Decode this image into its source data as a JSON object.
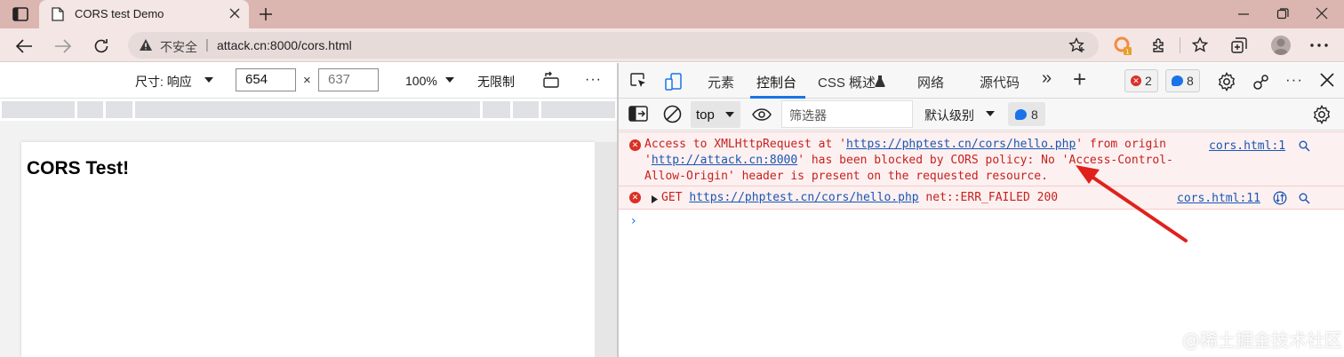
{
  "browser": {
    "tab_title": "CORS test Demo",
    "address": {
      "security_label": "不安全",
      "separator": "|",
      "url": "attack.cn:8000/cors.html"
    }
  },
  "device_toolbar": {
    "dimensions_label": "尺寸: 响应",
    "width_value": "654",
    "times": "×",
    "height_value": "637",
    "zoom_label": "100%",
    "throttle_label": "无限制",
    "more_label": "···"
  },
  "page": {
    "heading": "CORS Test!"
  },
  "devtools": {
    "tabs": [
      {
        "label": "元素"
      },
      {
        "label": "控制台",
        "active": true
      },
      {
        "label": "CSS 概述"
      },
      {
        "label": "网络"
      },
      {
        "label": "源代码"
      }
    ],
    "more_tabs": "»",
    "add_tab": "+",
    "error_count": "2",
    "issue_count": "8",
    "more_label": "···"
  },
  "console_toolbar": {
    "context": "top",
    "filter_placeholder": "筛选器",
    "level_label": "默认级别",
    "issues_count": "8"
  },
  "console": {
    "messages": [
      {
        "type": "error",
        "line1_a": "Access to XMLHttpRequest at '",
        "line1_link": "https://phptest.cn/cors/hello.php",
        "line1_b": "' from origin",
        "line2_a": "'",
        "line2_link": "http://attack.cn:8000",
        "line2_b": "' has been blocked by CORS policy: No 'Access-Control-",
        "line3": "Allow-Origin' header is present on the requested resource.",
        "source": "cors.html:1"
      },
      {
        "type": "error",
        "method": "GET",
        "link": "https://phptest.cn/cors/hello.php",
        "detail": "net::ERR_FAILED 200",
        "source": "cors.html:11"
      }
    ],
    "prompt": "›"
  },
  "watermark": "@稀土掘金技术社区",
  "colors": {
    "titlebar": "#dbb5b0",
    "error_text": "#c5221f",
    "error_bg": "#fdf0f0",
    "link": "#1a56b3",
    "accent": "#1a73e8",
    "annotation_arrow": "#e0211b"
  }
}
